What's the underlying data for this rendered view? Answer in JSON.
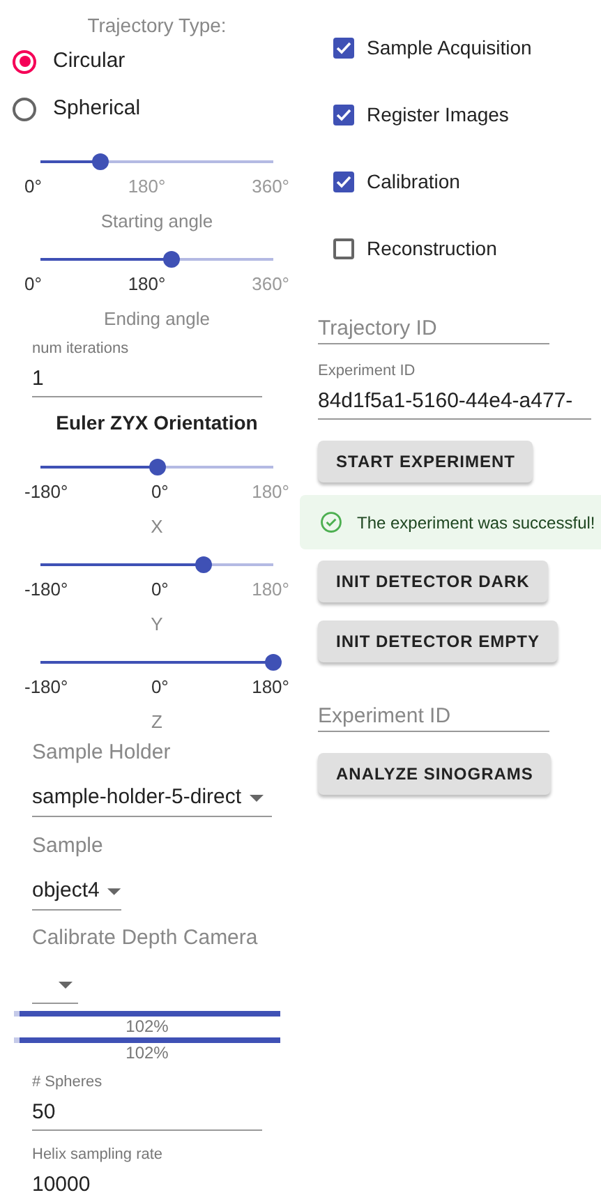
{
  "trajectory": {
    "title": "Trajectory Type:",
    "options": [
      {
        "label": "Circular",
        "selected": true
      },
      {
        "label": "Spherical",
        "selected": false
      }
    ]
  },
  "angle_sliders": [
    {
      "level": 0.26,
      "marks": [
        "0°",
        "180°",
        "360°"
      ],
      "caption": "Starting angle"
    },
    {
      "level": 0.56,
      "marks": [
        "0°",
        "180°",
        "360°"
      ],
      "caption": "Ending angle"
    }
  ],
  "num_iterations": {
    "label": "num iterations",
    "value": "1"
  },
  "orientation": {
    "title": "Euler ZYX Orientation",
    "sliders": [
      {
        "level": 0.5,
        "marks": [
          "-180°",
          "0°",
          "180°"
        ],
        "caption": "X"
      },
      {
        "level": 0.7,
        "marks": [
          "-180°",
          "0°",
          "180°"
        ],
        "caption": "Y"
      },
      {
        "level": 1,
        "marks": [
          "-180°",
          "0°",
          "180°"
        ],
        "caption": "Z"
      }
    ]
  },
  "sample_holder": {
    "label": "Sample Holder",
    "value": "sample-holder-5-direct"
  },
  "sample": {
    "label": "Sample",
    "value": "object4"
  },
  "calibrate_depth_camera": {
    "label": "Calibrate Depth Camera"
  },
  "progress_bars": [
    {
      "level": 1,
      "reading": "102%"
    },
    {
      "level": 1,
      "reading": "102%"
    }
  ],
  "spheres": {
    "label": "# Spheres",
    "value": "50"
  },
  "helix_sampling_rate": {
    "label": "Helix sampling rate",
    "value": "10000"
  },
  "steps": [
    {
      "label": "Sample Acquisition",
      "checked": true
    },
    {
      "label": "Register Images",
      "checked": true
    },
    {
      "label": "Calibration",
      "checked": true
    },
    {
      "label": "Reconstruction",
      "checked": false
    }
  ],
  "trajectory_id": {
    "placeholder": "Trajectory ID"
  },
  "experiment_id": {
    "label": "Experiment ID",
    "value": "84d1f5a1-5160-44e4-a477-"
  },
  "start_button": "START EXPERIMENT",
  "alert": {
    "text": "The experiment was successful!"
  },
  "detector_buttons": [
    "INIT DETECTOR DARK",
    "INIT DETECTOR EMPTY"
  ],
  "analysis_experiment_id": {
    "placeholder": "Experiment ID"
  },
  "analyze_button": "ANALYZE SINOGRAMS"
}
